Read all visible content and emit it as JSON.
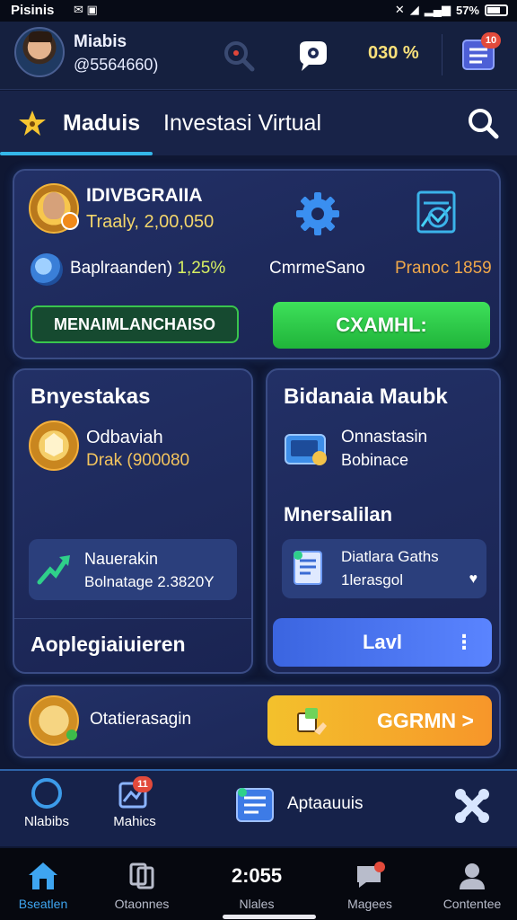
{
  "status_bar": {
    "carrier": "Pisinis",
    "battery": "57%"
  },
  "header": {
    "user_name": "Miabis",
    "user_id": "@5564660)",
    "percent_text": "030 %",
    "notif_badge": "10"
  },
  "tabs": {
    "active": "Maduis",
    "inactive": "Investasi Virtual"
  },
  "profile_card": {
    "name": "IDIVBGRAIIA",
    "trade": "Traaly, 2,00,050",
    "stat_label": "Baplraanden)",
    "stat_value": "1,25%",
    "mid_label": "CmrmeSano",
    "promo_label": "Pranoc 1859",
    "outline_button": "MENAIMLANCHAISO",
    "green_button": "CXAMHL:"
  },
  "invest_card": {
    "title": "Bnyestakas",
    "line1": "Odbaviah",
    "line2": "Drak (900080",
    "inner_line1": "Nauerakin",
    "inner_line2": "Bolnatage 2.3820Y",
    "footer": "Aoplegiaiuieren"
  },
  "market_card": {
    "title": "Bidanaia Maubk",
    "line1": "Onnastasin",
    "line2": "Bobinace",
    "subtitle": "Mnersalilan",
    "inner_line1": "Diatlara Gaths",
    "inner_line2": "1lerasgol",
    "button": "Lavl"
  },
  "bonus_card": {
    "label": "Otatierasagin",
    "button": "GGRMN >"
  },
  "subnav": {
    "item1": "Nlabibs",
    "item2": "Mahics",
    "badge": "11",
    "item3": "Aptaauuis"
  },
  "bottom_nav": {
    "home": "Bseatlen",
    "item2": "Otaonnes",
    "time": "2:055",
    "item3": "Nlales",
    "item4": "Magees",
    "item5": "Contentee"
  },
  "colors": {
    "accent": "#34b7e9",
    "green": "#2fd24c",
    "orange": "#f5a92b",
    "blue": "#4a73ee",
    "background": "#0f1733"
  }
}
